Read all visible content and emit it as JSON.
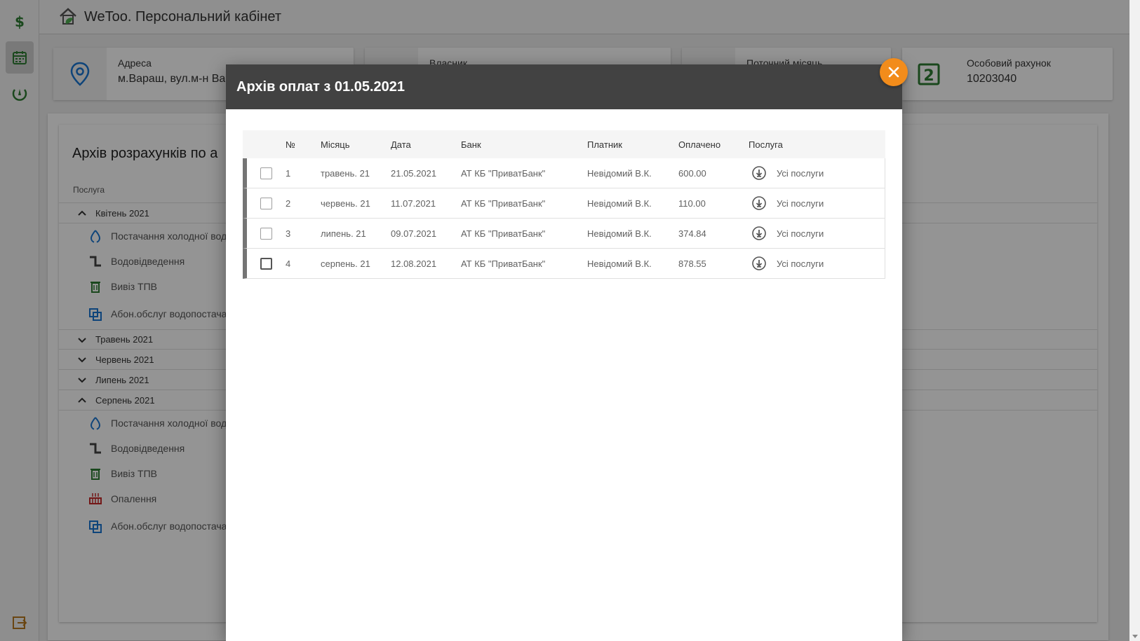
{
  "app": {
    "title": "WeToo. Персональний кабінет"
  },
  "cards": {
    "address": {
      "label": "Адреса",
      "value": "м.Вараш, вул.м-н Ва"
    },
    "owner": {
      "label": "Власник"
    },
    "month": {
      "label": "Поточний місяць"
    },
    "account": {
      "label": "Особовий рахунок",
      "value": "10203040",
      "icon_text": "2"
    }
  },
  "archive_panel": {
    "title": "Архів розрахунків по а",
    "service_header": "Послуга",
    "months": [
      {
        "label": "Квітень 2021",
        "expanded": true,
        "services": [
          "Постачання холодної вод",
          "Водовідведення",
          "Вивіз ТПВ",
          "Абон.обслуг водопостача (хол)"
        ]
      },
      {
        "label": "Травень 2021",
        "expanded": false
      },
      {
        "label": "Червень 2021",
        "expanded": false
      },
      {
        "label": "Липень 2021",
        "expanded": false
      },
      {
        "label": "Серпень 2021",
        "expanded": true,
        "services": [
          "Постачання холодної вод",
          "Водовідведення",
          "Вивіз ТПВ",
          "Опалення",
          "Абон.обслуг водопостача (хол)"
        ]
      }
    ]
  },
  "modal": {
    "title": "Архів оплат з 01.05.2021",
    "columns": {
      "num": "№",
      "month": "Місяць",
      "date": "Дата",
      "bank": "Банк",
      "payer": "Платник",
      "paid": "Оплачено",
      "service": "Послуга"
    },
    "rows": [
      {
        "num": "1",
        "month": "травень. 21",
        "date": "21.05.2021",
        "bank": "АТ КБ \"ПриватБанк\"",
        "payer": "Невідомий В.К.",
        "paid": "600.00",
        "service": "Усі послуги"
      },
      {
        "num": "2",
        "month": "червень. 21",
        "date": "11.07.2021",
        "bank": "АТ КБ \"ПриватБанк\"",
        "payer": "Невідомий В.К.",
        "paid": "110.00",
        "service": "Усі послуги"
      },
      {
        "num": "3",
        "month": "липень. 21",
        "date": "09.07.2021",
        "bank": "АТ КБ \"ПриватБанк\"",
        "payer": "Невідомий В.К.",
        "paid": "374.84",
        "service": "Усі послуги"
      },
      {
        "num": "4",
        "month": "серпень. 21",
        "date": "12.08.2021",
        "bank": "АТ КБ \"ПриватБанк\"",
        "payer": "Невідомий В.К.",
        "paid": "878.55",
        "service": "Усі послуги"
      }
    ]
  },
  "icons": {
    "sidebar": [
      "dollar-icon",
      "calendar-icon",
      "meter-icon",
      "logout-icon"
    ],
    "close": "close-icon",
    "download": "download-icon"
  },
  "colors": {
    "accent_orange": "#f28c1b",
    "sidebar_green": "#2e7d32",
    "modal_header": "#424242",
    "water_blue": "#1976d2"
  }
}
